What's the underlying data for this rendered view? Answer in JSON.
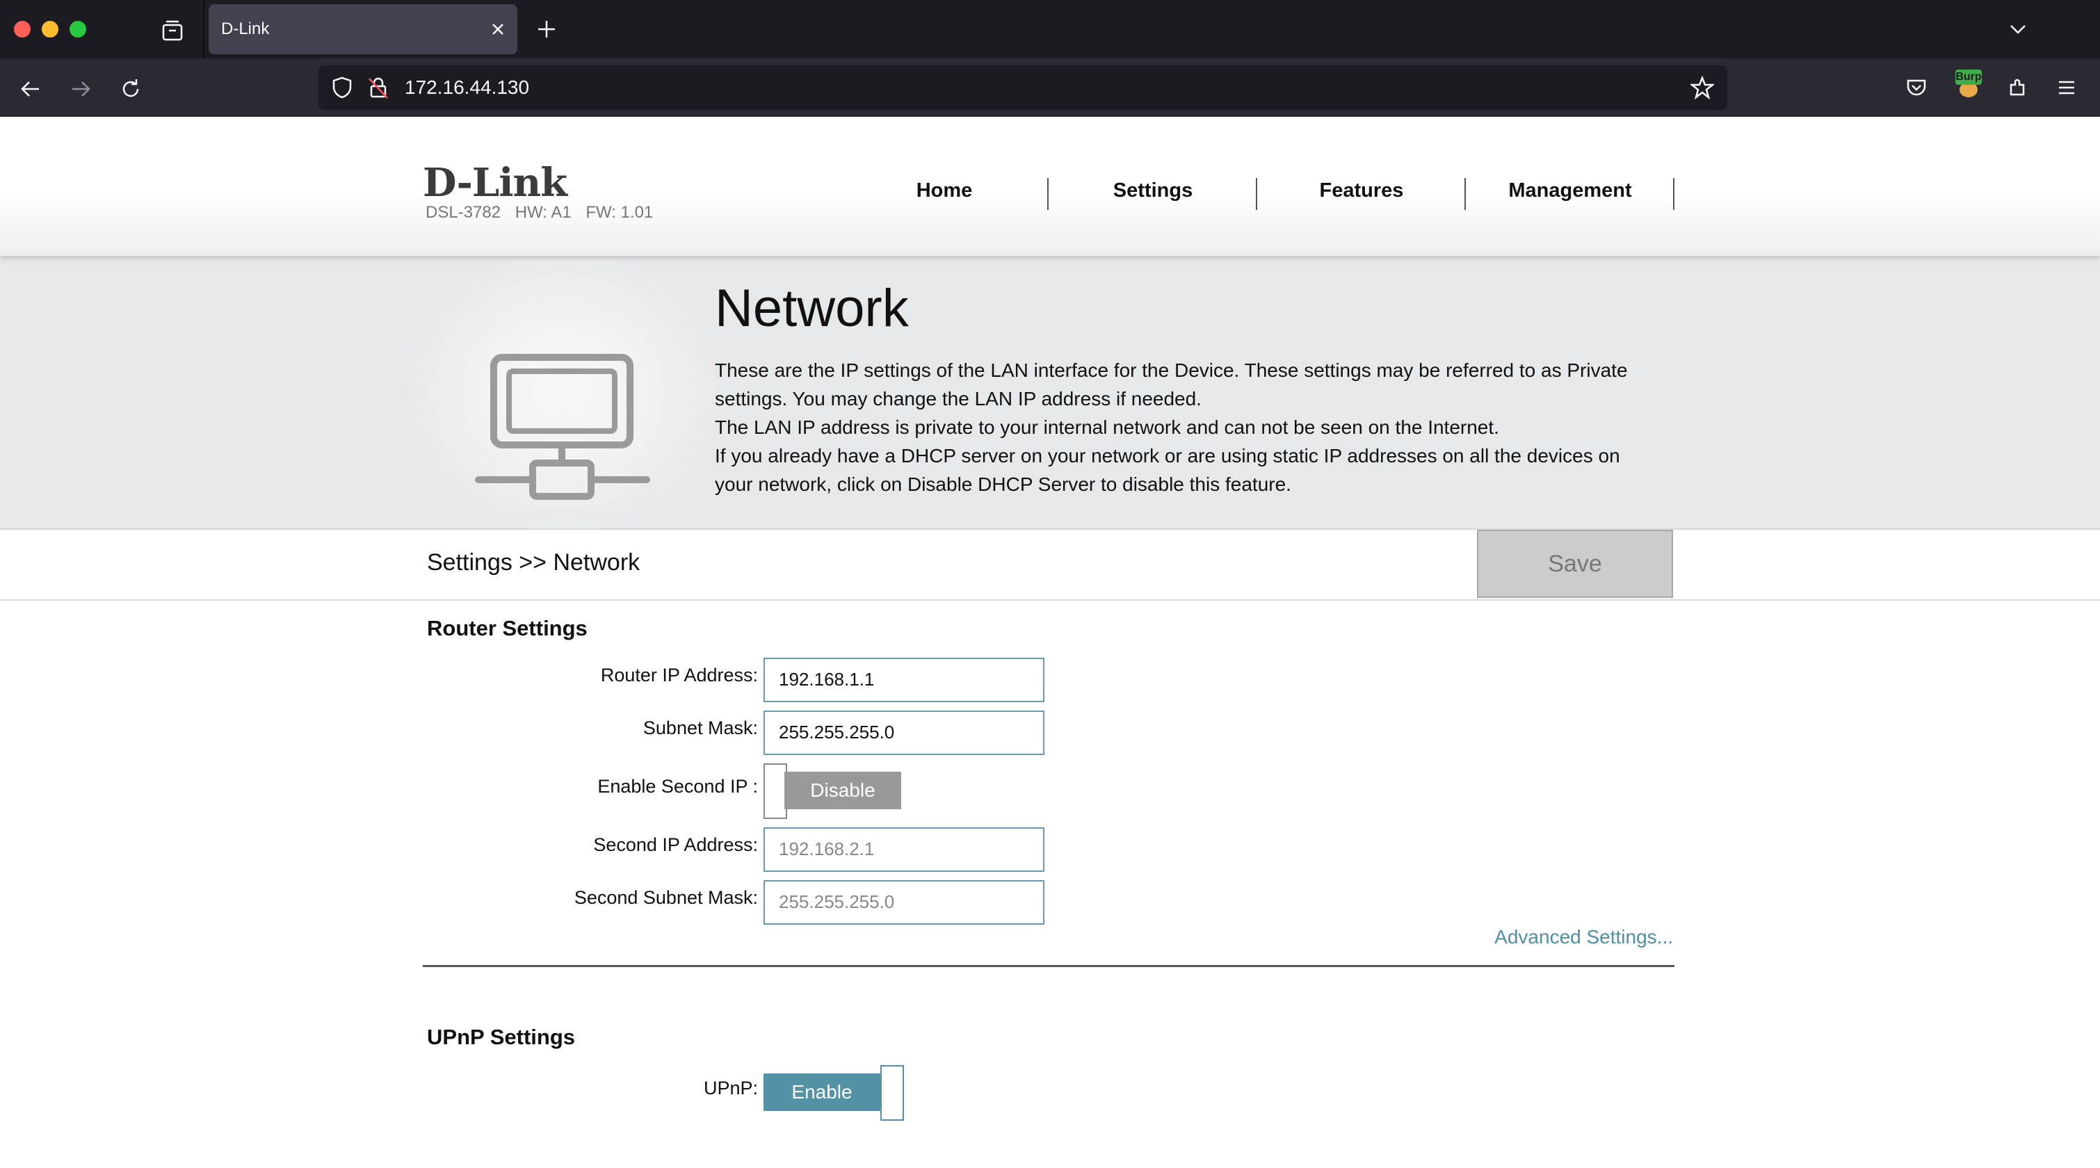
{
  "browser": {
    "tab_title": "D-Link",
    "url": "172.16.44.130"
  },
  "header": {
    "logo": "D-Link",
    "model": "DSL-3782",
    "hw": "HW: A1",
    "fw": "FW: 1.01",
    "nav": [
      "Home",
      "Settings",
      "Features",
      "Management"
    ]
  },
  "hero": {
    "title": "Network",
    "paragraphs": [
      "These are the IP settings of the LAN interface for the Device. These settings may be referred to as Private settings. You may change the LAN IP address if needed.",
      "The LAN IP address is private to your internal network and can not be seen on the Internet.",
      "If you already have a DHCP server on your network or are using static IP addresses on all the devices on your network, click on Disable DHCP Server to disable this feature."
    ]
  },
  "breadcrumb": "Settings >> Network",
  "save_label": "Save",
  "router_settings": {
    "title": "Router Settings",
    "router_ip_label": "Router IP Address:",
    "router_ip_value": "192.168.1.1",
    "subnet_label": "Subnet Mask:",
    "subnet_value": "255.255.255.0",
    "second_ip_toggle_label": "Enable Second IP :",
    "second_ip_toggle_state": "Disable",
    "second_ip_label": "Second IP Address:",
    "second_ip_value": "192.168.2.1",
    "second_subnet_label": "Second Subnet Mask:",
    "second_subnet_value": "255.255.255.0",
    "advanced_link": "Advanced Settings..."
  },
  "upnp_settings": {
    "title": "UPnP Settings",
    "upnp_label": "UPnP:",
    "upnp_state": "Enable"
  },
  "colors": {
    "accent": "#5492a5",
    "link": "#4f8fa6",
    "chrome_dark": "#1c1b22"
  }
}
